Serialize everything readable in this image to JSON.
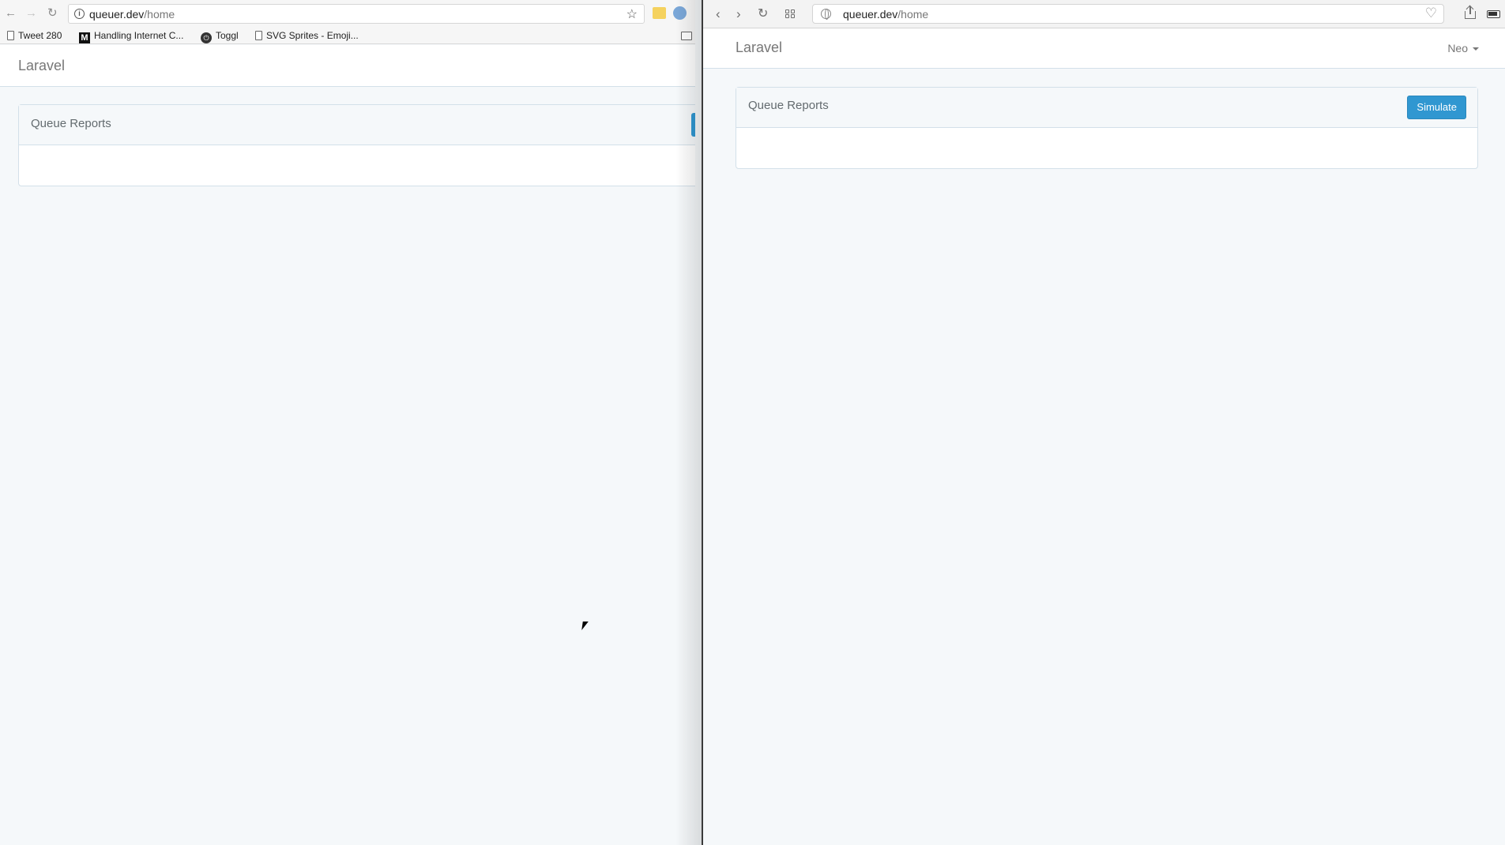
{
  "left_browser": {
    "url_host": "queuer.dev",
    "url_path": "/home",
    "bookmarks": [
      {
        "label": "Tweet 280",
        "icon": "document-icon"
      },
      {
        "label": "Handling Internet C...",
        "icon": "medium-m-icon"
      },
      {
        "label": "Toggl",
        "icon": "toggl-icon"
      },
      {
        "label": "SVG Sprites - Emoji...",
        "icon": "document-icon"
      }
    ],
    "app": {
      "brand": "Laravel",
      "panel_title": "Queue Reports"
    }
  },
  "right_browser": {
    "url_host": "queuer.dev",
    "url_path": "/home",
    "app": {
      "brand": "Laravel",
      "user_menu": "Neo",
      "panel_title": "Queue Reports",
      "simulate_label": "Simulate"
    }
  },
  "colors": {
    "primary_button": "#3097d1",
    "page_background": "#f5f8fa",
    "panel_border": "#d3e0e9"
  }
}
